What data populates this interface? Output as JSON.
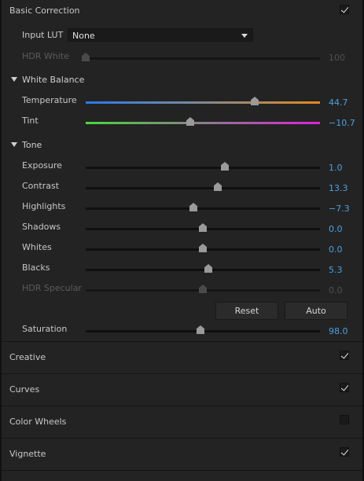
{
  "basic_correction": {
    "title": "Basic Correction",
    "enabled": true
  },
  "input_lut": {
    "label": "Input LUT",
    "value": "None"
  },
  "hdr_white": {
    "label": "HDR White",
    "value": "100",
    "position": 0
  },
  "white_balance": {
    "title": "White Balance",
    "temperature": {
      "label": "Temperature",
      "value": "44.7",
      "position": 72
    },
    "tint": {
      "label": "Tint",
      "value": "−10.7",
      "position": 44.5
    }
  },
  "tone": {
    "title": "Tone",
    "sliders": [
      {
        "label": "Exposure",
        "value": "1.0",
        "position": 59.5
      },
      {
        "label": "Contrast",
        "value": "13.3",
        "position": 56.5
      },
      {
        "label": "Highlights",
        "value": "−7.3",
        "position": 46
      },
      {
        "label": "Shadows",
        "value": "0.0",
        "position": 50
      },
      {
        "label": "Whites",
        "value": "0.0",
        "position": 50
      },
      {
        "label": "Blacks",
        "value": "5.3",
        "position": 52.5
      },
      {
        "label": "HDR Specular",
        "value": "0.0",
        "position": 50,
        "disabled": true
      }
    ],
    "reset_label": "Reset",
    "auto_label": "Auto"
  },
  "saturation": {
    "label": "Saturation",
    "value": "98.0",
    "position": 49
  },
  "sections": [
    {
      "title": "Creative",
      "enabled": true
    },
    {
      "title": "Curves",
      "enabled": true
    },
    {
      "title": "Color Wheels",
      "enabled": false
    },
    {
      "title": "Vignette",
      "enabled": true
    }
  ],
  "colors": {
    "value_blue": "#4aa0e0",
    "background": "#232323"
  }
}
